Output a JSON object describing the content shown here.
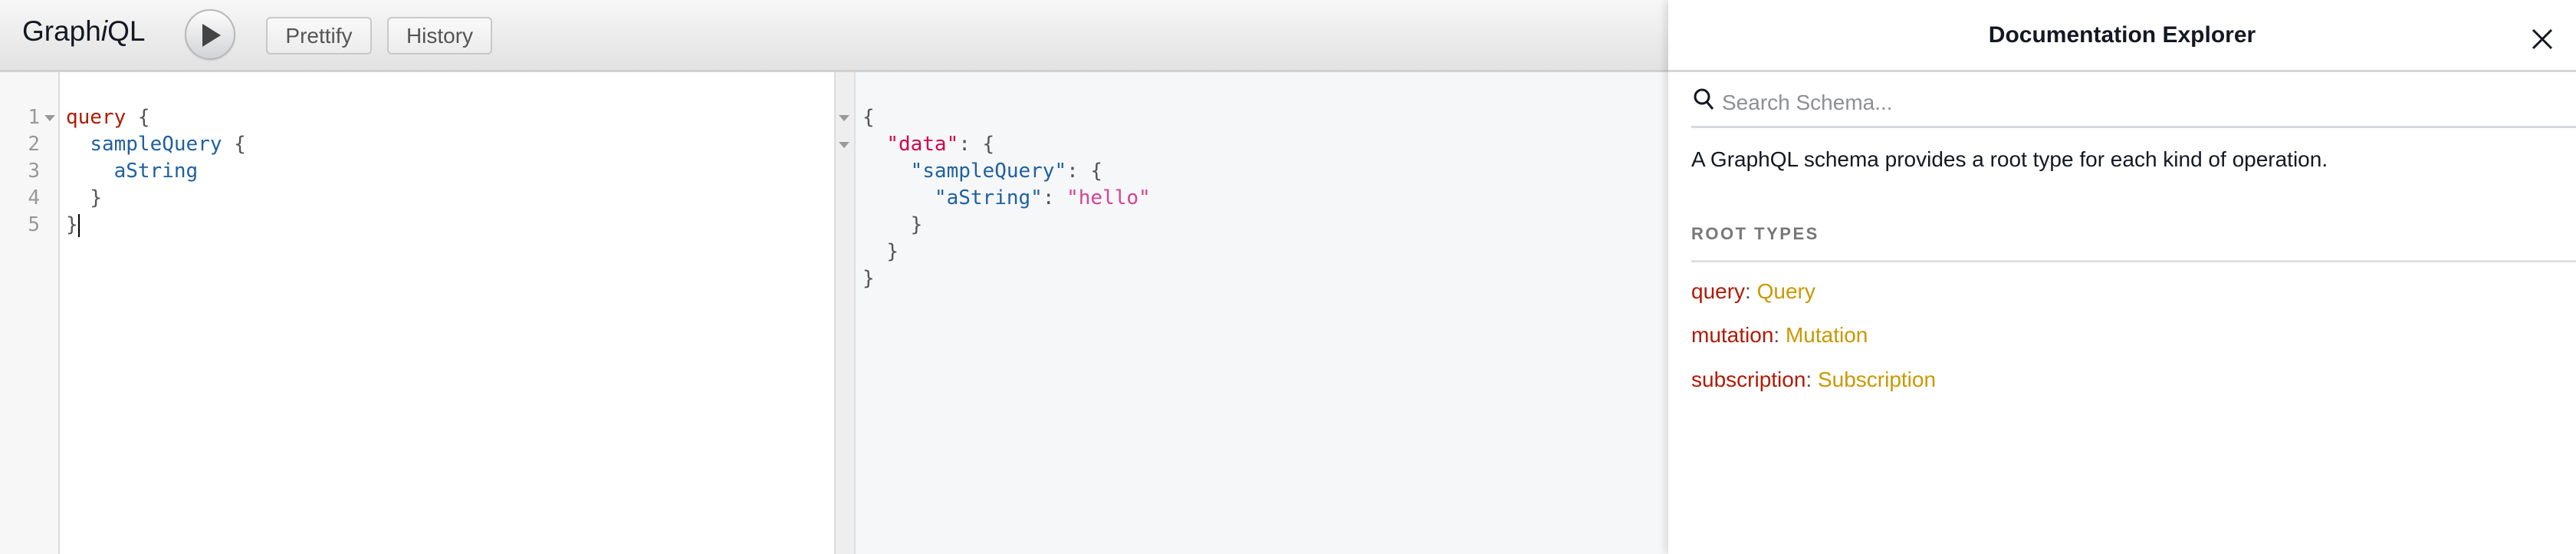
{
  "toolbar": {
    "logo_prefix": "Graph",
    "logo_italic": "i",
    "logo_suffix": "QL",
    "execute_icon": "play-icon",
    "prettify_label": "Prettify",
    "history_label": "History"
  },
  "query_editor": {
    "line_numbers": [
      "1",
      "2",
      "3",
      "4",
      "5"
    ],
    "lines": [
      {
        "keyword": "query",
        "rest": " {"
      },
      {
        "indent": "  ",
        "field": "sampleQuery",
        "rest": " {"
      },
      {
        "indent": "    ",
        "field": "aString"
      },
      {
        "indent": "  ",
        "rest": "}"
      },
      {
        "rest": "}"
      }
    ]
  },
  "result_viewer": {
    "lines": [
      {
        "punct": "{"
      },
      {
        "indent": "  ",
        "key": "\"data\"",
        "punct": ": {"
      },
      {
        "indent": "    ",
        "key": "\"sampleQuery\"",
        "punct": ": {"
      },
      {
        "indent": "      ",
        "key": "\"aString\"",
        "punct": ": ",
        "value": "\"hello\""
      },
      {
        "indent": "    ",
        "punct": "}"
      },
      {
        "indent": "  ",
        "punct": "}"
      },
      {
        "punct": "}"
      }
    ]
  },
  "doc_explorer": {
    "title": "Documentation Explorer",
    "close_icon": "close-icon",
    "search_placeholder": "Search Schema...",
    "search_value": "",
    "description": "A GraphQL schema provides a root type for each kind of operation.",
    "section_title": "ROOT TYPES",
    "root_types": [
      {
        "field": "query",
        "type": "Query"
      },
      {
        "field": "mutation",
        "type": "Mutation"
      },
      {
        "field": "subscription",
        "type": "Subscription"
      }
    ]
  },
  "colors": {
    "keyword": "#B11A04",
    "field": "#1F61A0",
    "json_data_key": "#D2054E",
    "json_string": "#D64292",
    "type_name": "#CA9800",
    "section_title": "#777777"
  }
}
